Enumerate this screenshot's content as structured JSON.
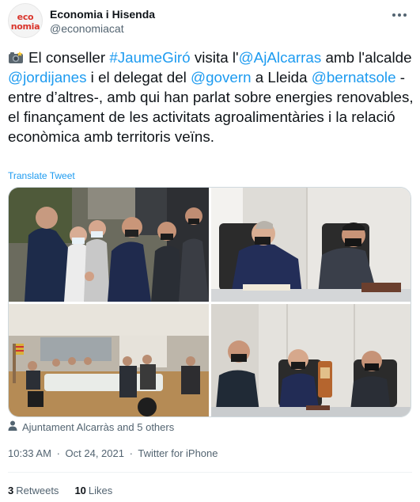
{
  "author": {
    "avatar_line1": "eco",
    "avatar_line2": "nomia",
    "name": "Economia i Hisenda",
    "handle": "@economiacat"
  },
  "tweet": {
    "emoji": "camera-flash-icon",
    "segments": [
      {
        "type": "text",
        "value": "El conseller "
      },
      {
        "type": "hashtag",
        "value": "#JaumeGiró"
      },
      {
        "type": "text",
        "value": " visita l'"
      },
      {
        "type": "mention",
        "value": "@AjAlcarras"
      },
      {
        "type": "text",
        "value": " amb l'alcalde "
      },
      {
        "type": "mention",
        "value": "@jordijanes"
      },
      {
        "type": "text",
        "value": " i el delegat del "
      },
      {
        "type": "mention",
        "value": "@govern"
      },
      {
        "type": "text",
        "value": " a Lleida "
      },
      {
        "type": "mention",
        "value": "@bernatsole"
      },
      {
        "type": "text",
        "value": " -entre d’altres-, amb qui han parlat sobre energies renovables, el finançament de les activitats agroalimentàries i la relació econòmica amb territoris veïns."
      }
    ],
    "translate_label": "Translate Tweet"
  },
  "media": {
    "photo_count": 4
  },
  "tagged": {
    "icon": "person-icon",
    "text": "Ajuntament Alcarràs and 5 others"
  },
  "meta": {
    "time": "10:33 AM",
    "separator": "·",
    "date": "Oct 24, 2021",
    "source": "Twitter for iPhone"
  },
  "stats": {
    "retweets_count": "3",
    "retweets_label": "Retweets",
    "likes_count": "10",
    "likes_label": "Likes"
  },
  "colors": {
    "link": "#1d9bf0",
    "text": "#0f1419",
    "secondary": "#536471",
    "brand_red": "#d9352c"
  }
}
